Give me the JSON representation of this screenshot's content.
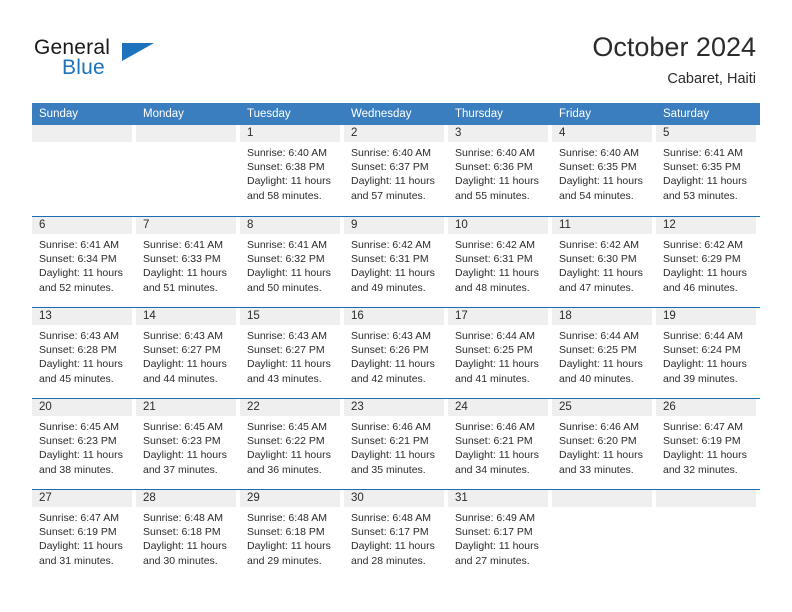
{
  "brand": {
    "word_top": "General",
    "word_bottom": "Blue",
    "icon": "triangle-logo"
  },
  "header": {
    "month_title": "October 2024",
    "location": "Cabaret, Haiti"
  },
  "colors": {
    "header_blue": "#3a7ebf",
    "row_border_blue": "#1c6cb3",
    "day_band_gray": "#efefef",
    "brand_blue": "#1c72bb",
    "text": "#2b2b2b"
  },
  "calendar": {
    "day_headers": [
      "Sunday",
      "Monday",
      "Tuesday",
      "Wednesday",
      "Thursday",
      "Friday",
      "Saturday"
    ],
    "weeks": [
      [
        {
          "date": "",
          "empty": true
        },
        {
          "date": "",
          "empty": true
        },
        {
          "date": "1",
          "sunrise": "Sunrise: 6:40 AM",
          "sunset": "Sunset: 6:38 PM",
          "daylight": "Daylight: 11 hours and 58 minutes."
        },
        {
          "date": "2",
          "sunrise": "Sunrise: 6:40 AM",
          "sunset": "Sunset: 6:37 PM",
          "daylight": "Daylight: 11 hours and 57 minutes."
        },
        {
          "date": "3",
          "sunrise": "Sunrise: 6:40 AM",
          "sunset": "Sunset: 6:36 PM",
          "daylight": "Daylight: 11 hours and 55 minutes."
        },
        {
          "date": "4",
          "sunrise": "Sunrise: 6:40 AM",
          "sunset": "Sunset: 6:35 PM",
          "daylight": "Daylight: 11 hours and 54 minutes."
        },
        {
          "date": "5",
          "sunrise": "Sunrise: 6:41 AM",
          "sunset": "Sunset: 6:35 PM",
          "daylight": "Daylight: 11 hours and 53 minutes."
        }
      ],
      [
        {
          "date": "6",
          "sunrise": "Sunrise: 6:41 AM",
          "sunset": "Sunset: 6:34 PM",
          "daylight": "Daylight: 11 hours and 52 minutes."
        },
        {
          "date": "7",
          "sunrise": "Sunrise: 6:41 AM",
          "sunset": "Sunset: 6:33 PM",
          "daylight": "Daylight: 11 hours and 51 minutes."
        },
        {
          "date": "8",
          "sunrise": "Sunrise: 6:41 AM",
          "sunset": "Sunset: 6:32 PM",
          "daylight": "Daylight: 11 hours and 50 minutes."
        },
        {
          "date": "9",
          "sunrise": "Sunrise: 6:42 AM",
          "sunset": "Sunset: 6:31 PM",
          "daylight": "Daylight: 11 hours and 49 minutes."
        },
        {
          "date": "10",
          "sunrise": "Sunrise: 6:42 AM",
          "sunset": "Sunset: 6:31 PM",
          "daylight": "Daylight: 11 hours and 48 minutes."
        },
        {
          "date": "11",
          "sunrise": "Sunrise: 6:42 AM",
          "sunset": "Sunset: 6:30 PM",
          "daylight": "Daylight: 11 hours and 47 minutes."
        },
        {
          "date": "12",
          "sunrise": "Sunrise: 6:42 AM",
          "sunset": "Sunset: 6:29 PM",
          "daylight": "Daylight: 11 hours and 46 minutes."
        }
      ],
      [
        {
          "date": "13",
          "sunrise": "Sunrise: 6:43 AM",
          "sunset": "Sunset: 6:28 PM",
          "daylight": "Daylight: 11 hours and 45 minutes."
        },
        {
          "date": "14",
          "sunrise": "Sunrise: 6:43 AM",
          "sunset": "Sunset: 6:27 PM",
          "daylight": "Daylight: 11 hours and 44 minutes."
        },
        {
          "date": "15",
          "sunrise": "Sunrise: 6:43 AM",
          "sunset": "Sunset: 6:27 PM",
          "daylight": "Daylight: 11 hours and 43 minutes."
        },
        {
          "date": "16",
          "sunrise": "Sunrise: 6:43 AM",
          "sunset": "Sunset: 6:26 PM",
          "daylight": "Daylight: 11 hours and 42 minutes."
        },
        {
          "date": "17",
          "sunrise": "Sunrise: 6:44 AM",
          "sunset": "Sunset: 6:25 PM",
          "daylight": "Daylight: 11 hours and 41 minutes."
        },
        {
          "date": "18",
          "sunrise": "Sunrise: 6:44 AM",
          "sunset": "Sunset: 6:25 PM",
          "daylight": "Daylight: 11 hours and 40 minutes."
        },
        {
          "date": "19",
          "sunrise": "Sunrise: 6:44 AM",
          "sunset": "Sunset: 6:24 PM",
          "daylight": "Daylight: 11 hours and 39 minutes."
        }
      ],
      [
        {
          "date": "20",
          "sunrise": "Sunrise: 6:45 AM",
          "sunset": "Sunset: 6:23 PM",
          "daylight": "Daylight: 11 hours and 38 minutes."
        },
        {
          "date": "21",
          "sunrise": "Sunrise: 6:45 AM",
          "sunset": "Sunset: 6:23 PM",
          "daylight": "Daylight: 11 hours and 37 minutes."
        },
        {
          "date": "22",
          "sunrise": "Sunrise: 6:45 AM",
          "sunset": "Sunset: 6:22 PM",
          "daylight": "Daylight: 11 hours and 36 minutes."
        },
        {
          "date": "23",
          "sunrise": "Sunrise: 6:46 AM",
          "sunset": "Sunset: 6:21 PM",
          "daylight": "Daylight: 11 hours and 35 minutes."
        },
        {
          "date": "24",
          "sunrise": "Sunrise: 6:46 AM",
          "sunset": "Sunset: 6:21 PM",
          "daylight": "Daylight: 11 hours and 34 minutes."
        },
        {
          "date": "25",
          "sunrise": "Sunrise: 6:46 AM",
          "sunset": "Sunset: 6:20 PM",
          "daylight": "Daylight: 11 hours and 33 minutes."
        },
        {
          "date": "26",
          "sunrise": "Sunrise: 6:47 AM",
          "sunset": "Sunset: 6:19 PM",
          "daylight": "Daylight: 11 hours and 32 minutes."
        }
      ],
      [
        {
          "date": "27",
          "sunrise": "Sunrise: 6:47 AM",
          "sunset": "Sunset: 6:19 PM",
          "daylight": "Daylight: 11 hours and 31 minutes."
        },
        {
          "date": "28",
          "sunrise": "Sunrise: 6:48 AM",
          "sunset": "Sunset: 6:18 PM",
          "daylight": "Daylight: 11 hours and 30 minutes."
        },
        {
          "date": "29",
          "sunrise": "Sunrise: 6:48 AM",
          "sunset": "Sunset: 6:18 PM",
          "daylight": "Daylight: 11 hours and 29 minutes."
        },
        {
          "date": "30",
          "sunrise": "Sunrise: 6:48 AM",
          "sunset": "Sunset: 6:17 PM",
          "daylight": "Daylight: 11 hours and 28 minutes."
        },
        {
          "date": "31",
          "sunrise": "Sunrise: 6:49 AM",
          "sunset": "Sunset: 6:17 PM",
          "daylight": "Daylight: 11 hours and 27 minutes."
        },
        {
          "date": "",
          "empty": true
        },
        {
          "date": "",
          "empty": true
        }
      ]
    ]
  }
}
